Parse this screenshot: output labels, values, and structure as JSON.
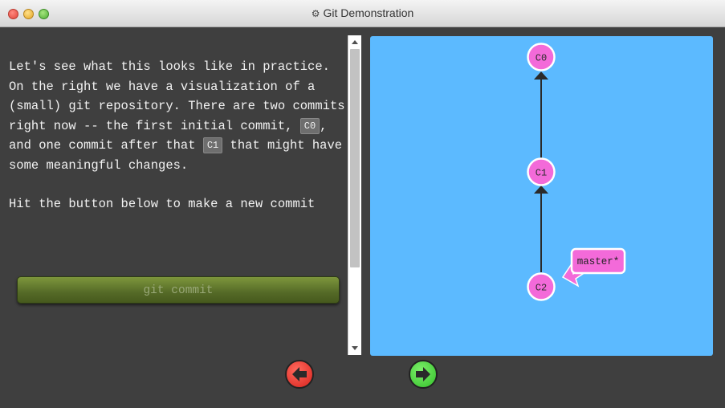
{
  "window": {
    "title": "Git Demonstration",
    "title_icon": "gear-icon"
  },
  "instructions": {
    "p1_a": "Let's see what this looks like in practice. On the right we have a visualization of a (small) git repository. There are two commits right now -- the first initial commit, ",
    "p1_code1": "C0",
    "p1_b": ", and one commit after that ",
    "p1_code2": "C1",
    "p1_c": " that might have some meaningful changes.",
    "p2": "Hit the button below to make a new commit"
  },
  "commit_button": {
    "label": "git commit"
  },
  "graph": {
    "commits": [
      {
        "id": "C0"
      },
      {
        "id": "C1"
      },
      {
        "id": "C2"
      }
    ],
    "branch": {
      "label": "master*"
    },
    "colors": {
      "background": "#5cbaff",
      "commit_fill": "#f36ad9",
      "commit_stroke": "#ffffff",
      "edge": "#2a2a2a",
      "branch_fill": "#f36ad9"
    }
  },
  "nav": {
    "prev_icon": "left-arrow-icon",
    "next_icon": "right-arrow-icon",
    "prev_color": "#e03a2f",
    "next_color": "#3ecf33"
  }
}
